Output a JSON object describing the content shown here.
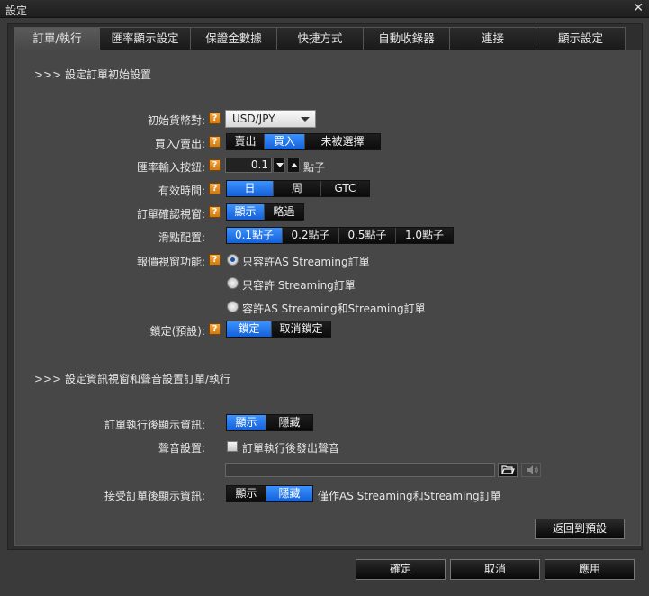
{
  "window": {
    "title": "設定",
    "close_label": "✕"
  },
  "tabs": [
    {
      "label": "訂單/執行"
    },
    {
      "label": "匯率顯示設定"
    },
    {
      "label": "保證金數據"
    },
    {
      "label": "快捷方式"
    },
    {
      "label": "自動收錄器"
    },
    {
      "label": "連接"
    },
    {
      "label": "顯示設定"
    }
  ],
  "section1": {
    "title": ">>> 設定訂單初始設置",
    "help_glyph": "?",
    "initial_pair": {
      "label": "初始貨幣對:",
      "value": "USD/JPY"
    },
    "buy_sell": {
      "label": "買入/賣出:",
      "options": [
        "賣出",
        "買入",
        "未被選擇"
      ],
      "selected": "買入"
    },
    "rate_step": {
      "label": "匯率輸入按鈕:",
      "value": "0.1",
      "unit": "點子"
    },
    "validity": {
      "label": "有效時間:",
      "options": [
        "日",
        "周",
        "GTC"
      ],
      "selected": "日"
    },
    "confirm_window": {
      "label": "訂單確認視窗:",
      "options": [
        "顯示",
        "略過"
      ],
      "selected": "顯示"
    },
    "slippage": {
      "label": "滑點配置:",
      "options": [
        "0.1點子",
        "0.2點子",
        "0.5點子",
        "1.0點子"
      ],
      "selected": "0.1點子"
    },
    "quote_window": {
      "label": "報價視窗功能:",
      "options": [
        "只容許AS Streaming訂單",
        "只容許 Streaming訂單",
        "容許AS Streaming和Streaming訂單"
      ],
      "selected": "只容許AS Streaming訂單"
    },
    "lock": {
      "label": "鎖定(預設):",
      "options": [
        "鎖定",
        "取消鎖定"
      ],
      "selected": "鎖定"
    }
  },
  "section2": {
    "title": ">>> 設定資訊視窗和聲音設置訂單/執行",
    "after_exec_info": {
      "label": "訂單執行後顯示資訊:",
      "options": [
        "顯示",
        "隱藏"
      ],
      "selected": "顯示"
    },
    "sound": {
      "label": "聲音設置:",
      "checkbox_label": "訂單執行後發出聲音",
      "checked": false
    },
    "after_accept_info": {
      "label": "接受訂單後顯示資訊:",
      "options": [
        "顯示",
        "隱藏"
      ],
      "selected": "隱藏",
      "trailing": "僅作AS Streaming和Streaming訂單"
    },
    "reset_label": "返回到預設"
  },
  "footer": {
    "ok_label": "確定",
    "cancel_label": "取消",
    "apply_label": "應用"
  },
  "colors": {
    "accent": "#1f74f0",
    "help": "#e8901f",
    "panel": "#474747"
  },
  "icons": {
    "folder": "folder-icon",
    "speaker": "speaker-icon"
  }
}
